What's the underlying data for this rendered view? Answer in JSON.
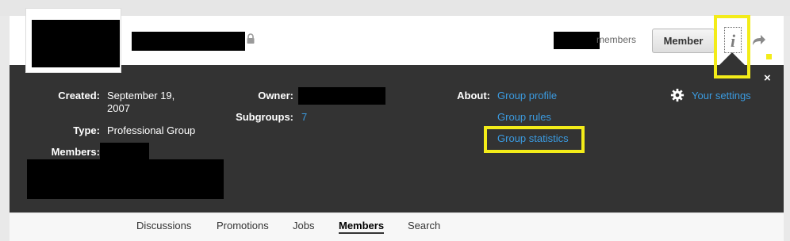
{
  "header": {
    "members_suffix": "members",
    "member_button": "Member",
    "info_icon_glyph": "i",
    "close_glyph": "×"
  },
  "details": {
    "created_label": "Created:",
    "created_value": "September 19, 2007",
    "type_label": "Type:",
    "type_value": "Professional Group",
    "members_label": "Members:",
    "owner_label": "Owner:",
    "subgroups_label": "Subgroups:",
    "subgroups_value": "7",
    "about_label": "About:",
    "about_links": [
      "Group profile",
      "Group rules",
      "Group statistics"
    ],
    "settings_link": "Your settings"
  },
  "tabs": [
    {
      "label": "Discussions",
      "active": false
    },
    {
      "label": "Promotions",
      "active": false
    },
    {
      "label": "Jobs",
      "active": false
    },
    {
      "label": "Members",
      "active": true
    },
    {
      "label": "Search",
      "active": false
    }
  ],
  "colors": {
    "panel": "#333333",
    "link": "#3b9be0",
    "highlight": "#f3ec19"
  },
  "icons": [
    "lock-icon",
    "info-icon",
    "share-icon",
    "close-icon",
    "gear-icon"
  ]
}
